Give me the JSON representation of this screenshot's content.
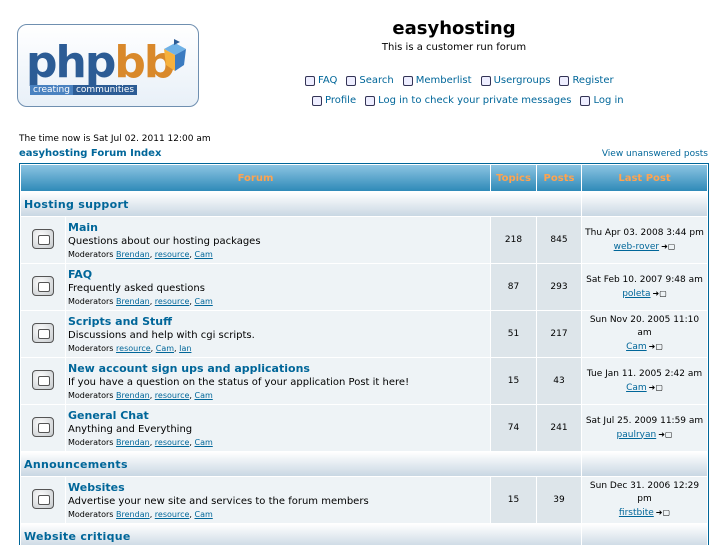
{
  "site": {
    "title": "easyhosting",
    "description": "This is a customer run forum"
  },
  "logo": {
    "word_a": "php",
    "word_b": "bb",
    "tag_a": "creating",
    "tag_b": "communities"
  },
  "nav_row1": [
    {
      "label": "FAQ",
      "icon": "faq-icon"
    },
    {
      "label": "Search",
      "icon": "search-icon"
    },
    {
      "label": "Memberlist",
      "icon": "memberlist-icon"
    },
    {
      "label": "Usergroups",
      "icon": "usergroups-icon"
    },
    {
      "label": "Register",
      "icon": "register-icon"
    }
  ],
  "nav_row2": [
    {
      "label": "Profile",
      "icon": "profile-icon"
    },
    {
      "label": "Log in to check your private messages",
      "icon": "messages-icon"
    },
    {
      "label": "Log in",
      "icon": "login-icon"
    }
  ],
  "time_text": "The time now is Sat Jul 02. 2011 12:00 am",
  "index_link": "easyhosting Forum Index",
  "unanswered_link": "View unanswered posts",
  "headers": {
    "forum": "Forum",
    "topics": "Topics",
    "posts": "Posts",
    "last_post": "Last Post"
  },
  "mod_label": "Moderators",
  "categories": [
    {
      "name": "Hosting support",
      "forums": [
        {
          "name": "Main",
          "desc": "Questions about our hosting packages",
          "mods": [
            "Brendan",
            "resource",
            "Cam"
          ],
          "topics": "218",
          "posts": "845",
          "last_date": "Thu Apr 03. 2008 3:44 pm",
          "last_user": "web-rover"
        },
        {
          "name": "FAQ",
          "desc": "Frequently asked questions",
          "mods": [
            "Brendan",
            "resource",
            "Cam"
          ],
          "topics": "87",
          "posts": "293",
          "last_date": "Sat Feb 10. 2007 9:48 am",
          "last_user": "poleta"
        },
        {
          "name": "Scripts and Stuff",
          "desc": "Discussions and help with cgi scripts.",
          "mods": [
            "resource",
            "Cam",
            "Ian"
          ],
          "topics": "51",
          "posts": "217",
          "last_date": "Sun Nov 20. 2005 11:10 am",
          "last_user": "Cam"
        },
        {
          "name": "New account sign ups and applications",
          "desc": "If you have a question on the status of your application Post it here!",
          "mods": [
            "Brendan",
            "resource",
            "Cam"
          ],
          "topics": "15",
          "posts": "43",
          "last_date": "Tue Jan 11. 2005 2:42 am",
          "last_user": "Cam"
        },
        {
          "name": "General Chat",
          "desc": "Anything and Everything",
          "mods": [
            "Brendan",
            "resource",
            "Cam"
          ],
          "topics": "74",
          "posts": "241",
          "last_date": "Sat Jul 25. 2009 11:59 am",
          "last_user": "paulryan"
        }
      ]
    },
    {
      "name": "Announcements",
      "forums": [
        {
          "name": "Websites",
          "desc": "Advertise your new site and services to the forum members",
          "mods": [
            "Brendan",
            "resource",
            "Cam"
          ],
          "topics": "15",
          "posts": "39",
          "last_date": "Sun Dec 31. 2006 12:29 pm",
          "last_user": "firstbite"
        }
      ]
    },
    {
      "name": "Website critique",
      "forums": []
    }
  ]
}
